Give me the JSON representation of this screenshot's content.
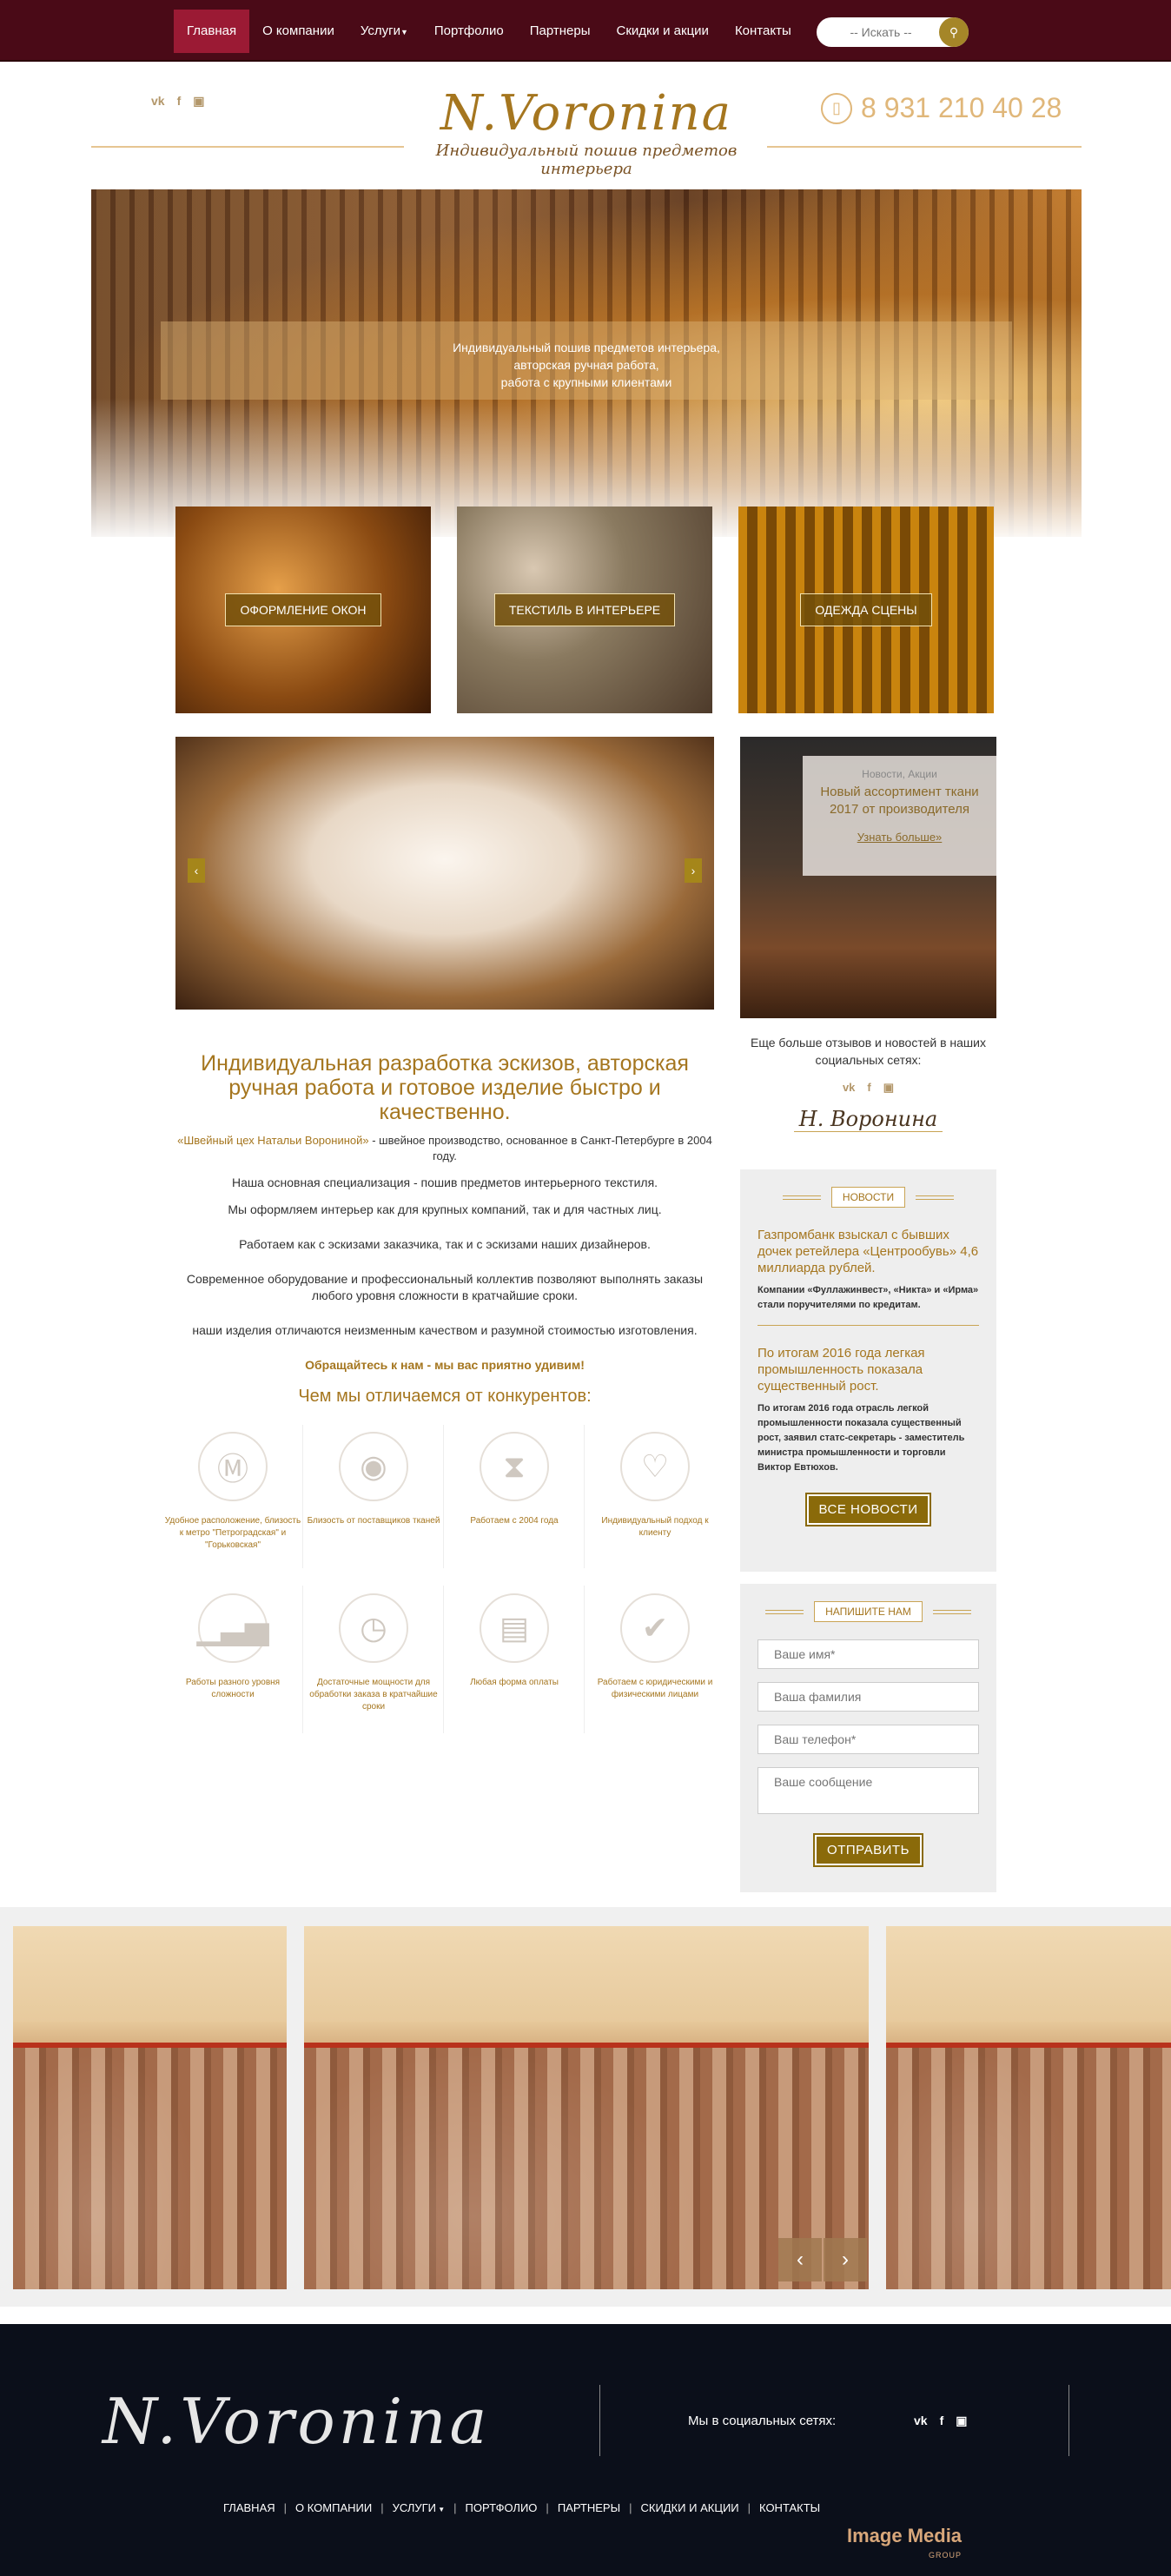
{
  "nav": {
    "items": [
      {
        "label": "Главная"
      },
      {
        "label": "О компании"
      },
      {
        "label": "Услуги"
      },
      {
        "label": "Портфолио"
      },
      {
        "label": "Партнеры"
      },
      {
        "label": "Скидки и акции"
      },
      {
        "label": "Контакты"
      }
    ],
    "search_placeholder": "-- Искать --"
  },
  "header": {
    "social": [
      "vk",
      "f",
      "ig"
    ],
    "logo_title": "N.Voronina",
    "logo_subtitle": "Индивидуальный пошив предметов интерьера",
    "phone": "8 931 210 40 28"
  },
  "hero": {
    "line1": "Индивидуальный пошив предметов интерьера,",
    "line2": "авторская ручная работа,",
    "line3": "работа с крупными клиентами"
  },
  "tiles": [
    {
      "label": "ОФОРМЛЕНИЕ ОКОН"
    },
    {
      "label": "ТЕКСТИЛЬ В ИНТЕРЬЕРЕ"
    },
    {
      "label": "ОДЕЖДА СЦЕНЫ"
    }
  ],
  "news_card": {
    "category": "Новости, Акции",
    "title": "Новый ассортимент ткани 2017 от производителя",
    "more": "Узнать больше»"
  },
  "social_block": {
    "text": "Еще больше отзывов и новостей в наших социальных сетях:",
    "signature": "Н. Воронина"
  },
  "main": {
    "heading": "Индивидуальная разработка эскизов, авторская ручная работа и готовое изделие быстро и качественно.",
    "intro_link": "«Швейный цех Натальи Ворониной»",
    "intro_rest": " - швейное производство, основанное в Санкт-Петербурге в 2004 году.",
    "p1": "Наша основная специализация - пошив предметов интерьерного текстиля.",
    "p2": "Мы оформляем интерьер как для крупных компаний, так и для частных лиц.",
    "p3": "Работаем как с эскизами заказчика, так и с эскизами наших дизайнеров.",
    "p4": "Современное оборудование и профессиональный коллектив позволяют выполнять заказы любого уровня сложности в кратчайшие сроки.",
    "p5": "наши изделия отличаются неизменным качеством и разумной стоимостью изготовления.",
    "cta": "Обращайтесь к нам - мы вас приятно удивим!",
    "compare_heading": "Чем мы отличаемся от конкурентов:"
  },
  "features": [
    {
      "icon": "metro-icon",
      "text": "Удобное расположение, близость к метро \"Петроградская\" и \"Горьковская\""
    },
    {
      "icon": "map-pin-icon",
      "text": "Близость от поставщиков тканей"
    },
    {
      "icon": "hourglass-icon",
      "text": "Работаем с 2004 года"
    },
    {
      "icon": "heart-icon",
      "text": "Индивидуальный подход к клиенту"
    },
    {
      "icon": "bar-chart-icon",
      "text": "Работы разного уровня сложности"
    },
    {
      "icon": "clock-icon",
      "text": "Достаточные мощности для обработки заказа в кратчайшие сроки"
    },
    {
      "icon": "wallet-icon",
      "text": "Любая форма оплаты"
    },
    {
      "icon": "check-icon",
      "text": "Работаем с юридическими и физическими лицами"
    }
  ],
  "news_box": {
    "header": "НОВОСТИ",
    "items": [
      {
        "title": "Газпромбанк взыскал с бывших дочек ретейлера «Центрообувь» 4,6 миллиарда рублей.",
        "body": "Компании «Фуллажинвест», «Никта» и «Ирма» стали поручителями по кредитам."
      },
      {
        "title": "По итогам 2016 года легкая промышленность показала существенный рост.",
        "body": "По итогам 2016 года отрасль легкой промышленности показала существенный рост, заявил статс-секретарь - заместитель министра промышленности и торговли Виктор Евтюхов."
      }
    ],
    "all_button": "ВСЕ НОВОСТИ"
  },
  "form": {
    "header": "НАПИШИТЕ НАМ",
    "name_placeholder": "Ваше имя*",
    "surname_placeholder": "Ваша фамилия",
    "phone_placeholder": "Ваш телефон*",
    "message_placeholder": "Ваше сообщение",
    "submit": "ОТПРАВИТЬ"
  },
  "footer": {
    "logo": "N.Voronina",
    "social_text": "Мы в социальных сетях:",
    "menu": [
      {
        "label": "ГЛАВНАЯ"
      },
      {
        "label": "О КОМПАНИИ"
      },
      {
        "label": "УСЛУГИ"
      },
      {
        "label": "ПОРТФОЛИО"
      },
      {
        "label": "ПАРТНЕРЫ"
      },
      {
        "label": "СКИДКИ И АКЦИИ"
      },
      {
        "label": "КОНТАКТЫ"
      }
    ],
    "brand": "Image Media",
    "brand_sub": "GROUP"
  }
}
